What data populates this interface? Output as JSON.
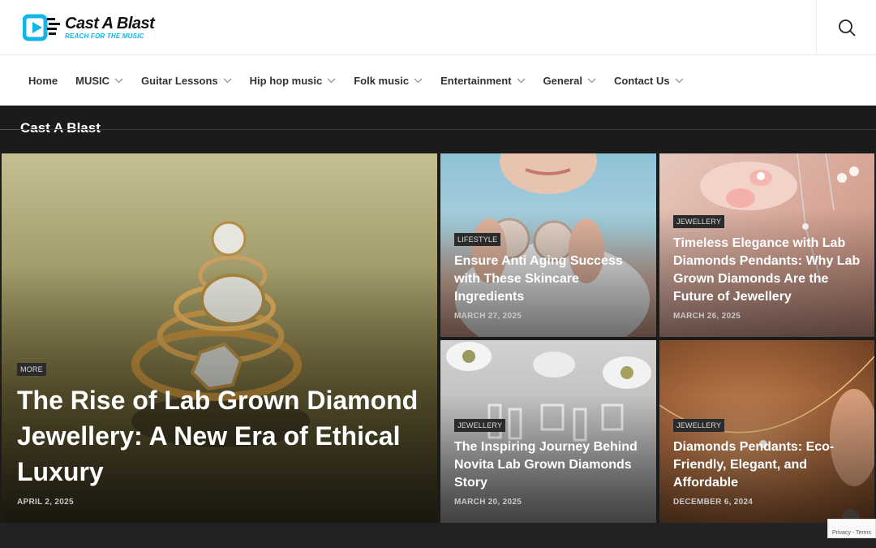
{
  "site": {
    "name": "Cast A Blast",
    "tagline": "REACH FOR THE MUSIC",
    "brand_color": "#13b5e8"
  },
  "header": {
    "search_icon": "search-icon"
  },
  "nav": {
    "items": [
      {
        "label": "Home",
        "has_dropdown": false
      },
      {
        "label": "MUSIC",
        "has_dropdown": true
      },
      {
        "label": "Guitar Lessons",
        "has_dropdown": true
      },
      {
        "label": "Hip hop music",
        "has_dropdown": true
      },
      {
        "label": "Folk music",
        "has_dropdown": true
      },
      {
        "label": "Entertainment",
        "has_dropdown": true
      },
      {
        "label": "General",
        "has_dropdown": true
      },
      {
        "label": "Contact Us",
        "has_dropdown": true
      }
    ]
  },
  "section": {
    "title": "Cast A Blast",
    "posts": [
      {
        "category": "MORE",
        "title": "The Rise of Lab Grown Diamond Jewellery: A New Era of Ethical Luxury",
        "date": "APRIL 2, 2025"
      },
      {
        "category": "LIFESTYLE",
        "title": "Ensure Anti Aging Success with These Skincare Ingredients",
        "date": "MARCH 27, 2025"
      },
      {
        "category": "JEWELLERY",
        "title": "Timeless Elegance with Lab Diamonds Pendants: Why Lab Grown Diamonds Are the Future of Jewellery",
        "date": "MARCH 26, 2025"
      },
      {
        "category": "JEWELLERY",
        "title": "The Inspiring Journey Behind Novita Lab Grown Diamonds Story",
        "date": "MARCH 20, 2025"
      },
      {
        "category": "JEWELLERY",
        "title": "Diamonds Pendants: Eco-Friendly, Elegant, and Affordable",
        "date": "DECEMBER 6, 2024"
      }
    ]
  },
  "recaptcha": {
    "text": "Privacy - Terms"
  }
}
